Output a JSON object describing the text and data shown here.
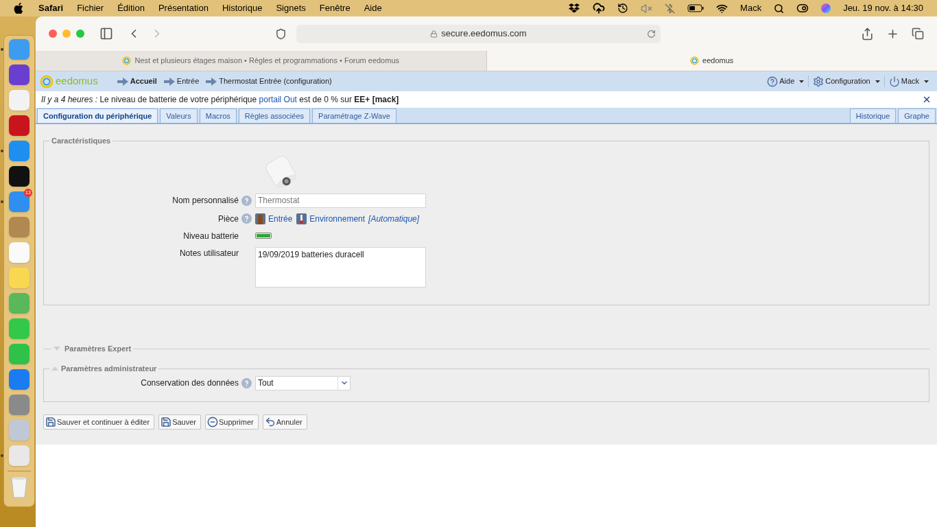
{
  "menubar": {
    "menus": [
      {
        "label": "Safari",
        "selected": true
      },
      {
        "label": "Fichier",
        "selected": false
      },
      {
        "label": "Édition",
        "selected": false
      },
      {
        "label": "Présentation",
        "selected": false
      },
      {
        "label": "Historique",
        "selected": false
      },
      {
        "label": "Signets",
        "selected": false
      },
      {
        "label": "Fenêtre",
        "selected": false
      },
      {
        "label": "Aide",
        "selected": false
      }
    ],
    "user": "Mack",
    "clock": "Jeu. 19 nov. à 14:30"
  },
  "dock": {
    "items": [
      {
        "color": "#3b9cf0",
        "running": true
      },
      {
        "color": "#6a3fd0",
        "running": false
      },
      {
        "color": "#f2f2f2",
        "running": false
      },
      {
        "color": "#c8141c",
        "running": false
      },
      {
        "color": "#1e8ef0",
        "running": true
      },
      {
        "color": "#111111",
        "running": false
      },
      {
        "color": "#2f8ff0",
        "running": true,
        "badge": "13"
      },
      {
        "color": "#b08850",
        "running": false
      },
      {
        "color": "#fafafa",
        "running": false
      },
      {
        "color": "#f7d850",
        "running": false
      },
      {
        "color": "#58b85a",
        "running": false
      },
      {
        "color": "#34c84a",
        "running": false
      },
      {
        "color": "#2ec24a",
        "running": false
      },
      {
        "color": "#1a7cf0",
        "running": false
      },
      {
        "color": "#8a8a8a",
        "running": false
      },
      {
        "color": "#c0c8d8",
        "running": false
      },
      {
        "color": "#e8e8e8",
        "running": true
      }
    ]
  },
  "browser": {
    "address": "secure.eedomus.com",
    "tabs": [
      {
        "title": "Nest et plusieurs étages maison • Règles et programmations • Forum eedomus",
        "selected": false
      },
      {
        "title": "eedomus",
        "selected": true
      }
    ]
  },
  "header": {
    "logo": "eedomus",
    "breadcrumb": [
      {
        "label": "Accueil",
        "current": true
      },
      {
        "label": "Entrée",
        "current": false
      },
      {
        "label": "Thermostat Entrée (configuration)",
        "current": false
      }
    ],
    "menus": [
      {
        "kind": "help",
        "label": "Aide"
      },
      {
        "kind": "settings",
        "label": "Configuration"
      },
      {
        "kind": "power",
        "label": "Mack"
      }
    ]
  },
  "notification": {
    "time": "Il y a 4 heures :",
    "before": "Le niveau de batterie de votre périphérique",
    "link": "portail Out",
    "after": "est de 0 % sur",
    "box": "EE+ [mack]"
  },
  "tabs": [
    {
      "label": "Configuration du périphérique",
      "selected": true
    },
    {
      "label": "Valeurs",
      "selected": false
    },
    {
      "label": "Macros",
      "selected": false
    },
    {
      "label": "Règles associées",
      "selected": false
    },
    {
      "label": "Paramétrage Z-Wave",
      "selected": false
    }
  ],
  "right_tabs": [
    {
      "label": "Historique",
      "selected": false
    },
    {
      "label": "Graphe",
      "selected": false
    }
  ],
  "characteristics": {
    "title": "Caractéristiques",
    "name_label": "Nom personnalisé",
    "name_value": "Thermostat",
    "room_label": "Pièce",
    "room": "Entrée",
    "usage": "Environnement",
    "usage_mode": "[Automatique]",
    "battery_label": "Niveau batterie",
    "battery": {
      "level": 1
    },
    "notes_label": "Notes utilisateur",
    "notes": "19/09/2019 batteries duracell"
  },
  "expert": {
    "title": "Paramètres Expert",
    "expanded": false
  },
  "admin": {
    "title": "Paramètres administrateur",
    "expanded": true,
    "retention_label": "Conservation des données",
    "retention": "Tout"
  },
  "buttons": [
    {
      "kind": "save",
      "label": "Sauver et continuer à éditer"
    },
    {
      "kind": "save",
      "label": "Sauver"
    },
    {
      "kind": "delete",
      "label": "Supprimer"
    },
    {
      "kind": "undo",
      "label": "Annuler"
    }
  ]
}
